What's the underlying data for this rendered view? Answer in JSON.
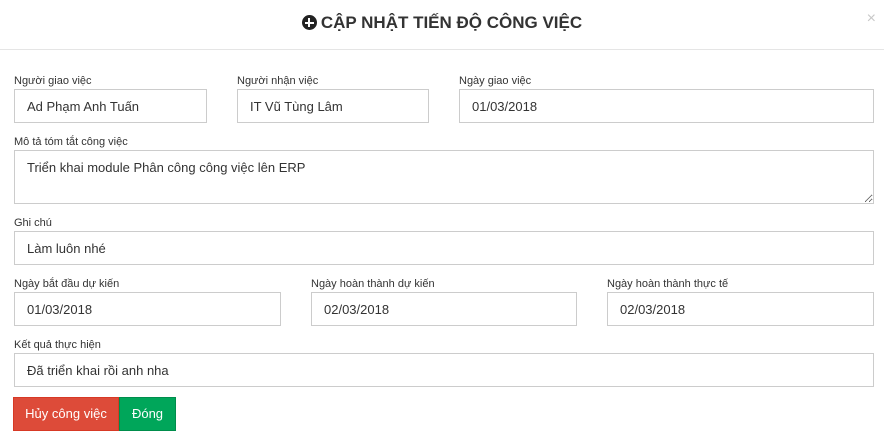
{
  "header": {
    "title": "CẬP NHẬT TIẾN ĐỘ CÔNG VIỆC",
    "close": "×"
  },
  "form": {
    "assigner": {
      "label": "Người giao việc",
      "value": "Ad Phạm Anh Tuấn"
    },
    "assignee": {
      "label": "Người nhận việc",
      "value": "IT Vũ Tùng Lâm"
    },
    "assign_date": {
      "label": "Ngày giao việc",
      "value": "01/03/2018"
    },
    "summary": {
      "label": "Mô tả tóm tắt công việc",
      "value": "Triển khai module Phân công công việc lên ERP"
    },
    "note": {
      "label": "Ghi chú",
      "value": "Làm luôn nhé"
    },
    "planned_start": {
      "label": "Ngày bắt đầu dự kiến",
      "value": "01/03/2018"
    },
    "planned_finish": {
      "label": "Ngày hoàn thành dự kiến",
      "value": "02/03/2018"
    },
    "actual_finish": {
      "label": "Ngày hoàn thành thực tế",
      "value": "02/03/2018"
    },
    "result": {
      "label": "Kết quả thực hiện",
      "value": "Đã triển khai rồi anh nha"
    }
  },
  "buttons": {
    "cancel_task": "Hủy công việc",
    "close": "Đóng"
  },
  "colors": {
    "cancel": "#dd4b39",
    "close": "#00a65a"
  }
}
